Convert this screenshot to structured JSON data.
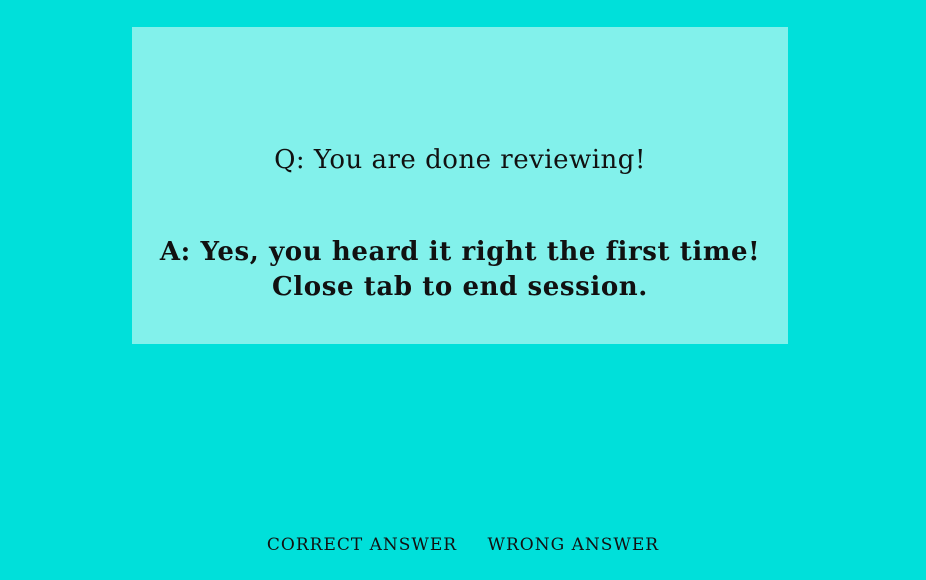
{
  "card": {
    "question": "Q: You are done reviewing!",
    "answer": "A: Yes, you heard it right the first time! Close tab to end session."
  },
  "actions": {
    "correct_label": "CORRECT ANSWER",
    "wrong_label": "WRONG ANSWER"
  },
  "colors": {
    "background": "#00e0da",
    "card_background": "#82f1eb",
    "text": "#111111"
  }
}
